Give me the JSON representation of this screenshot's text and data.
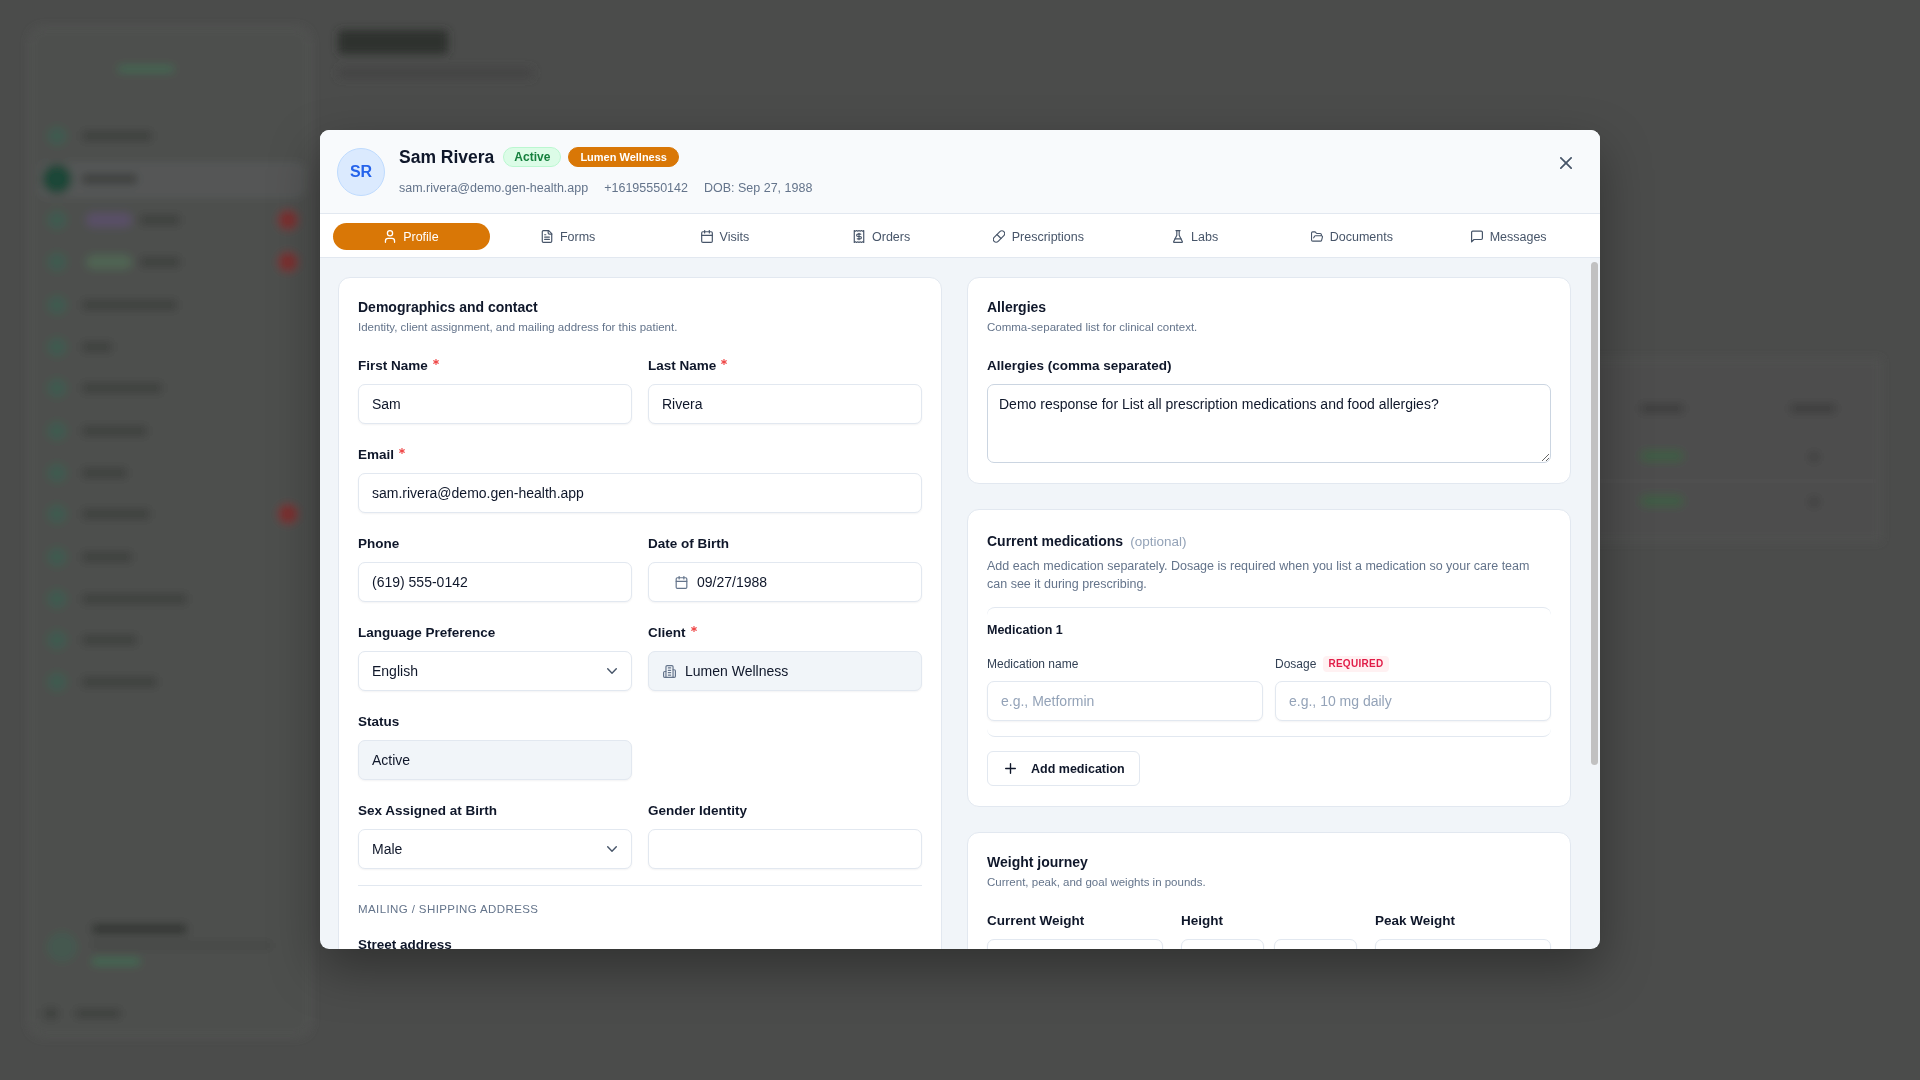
{
  "patient": {
    "initials": "SR",
    "name": "Sam Rivera",
    "badges": [
      {
        "label": "Active",
        "kind": "status"
      },
      {
        "label": "Lumen Wellness",
        "kind": "client"
      }
    ],
    "details": [
      "sam.rivera@demo.gen-health.app",
      "+16195550142",
      "DOB: Sep 27, 1988"
    ]
  },
  "tabs": [
    {
      "label": "Profile",
      "selected": true
    },
    {
      "label": "Forms",
      "selected": false
    },
    {
      "label": "Visits",
      "selected": false
    },
    {
      "label": "Orders",
      "selected": false
    },
    {
      "label": "Prescriptions",
      "selected": false
    },
    {
      "label": "Labs",
      "selected": false
    },
    {
      "label": "Documents",
      "selected": false
    },
    {
      "label": "Messages",
      "selected": false
    }
  ],
  "demographics": {
    "title": "Demographics and contact",
    "subtitle": "Identity, client assignment, and mailing address for this patient.",
    "rows": [
      [
        {
          "label": "First Name",
          "required": true,
          "kind": "text",
          "value": "Sam",
          "disabled": false
        },
        {
          "label": "Last Name",
          "required": true,
          "kind": "text",
          "value": "Rivera",
          "disabled": false
        }
      ],
      [
        {
          "label": "Email",
          "required": true,
          "kind": "email",
          "value": "sam.rivera@demo.gen-health.app",
          "disabled": false
        }
      ],
      [
        {
          "label": "Phone",
          "required": false,
          "kind": "text",
          "value": "(619) 555-0142",
          "disabled": false
        },
        {
          "label": "Date of Birth",
          "required": false,
          "kind": "date",
          "value": "09/27/1988",
          "disabled": false
        }
      ],
      [
        {
          "label": "Language Preference",
          "required": false,
          "kind": "select",
          "value": "English",
          "disabled": false
        },
        {
          "label": "Client",
          "required": true,
          "kind": "org",
          "value": "Lumen Wellness",
          "disabled": true
        }
      ],
      [
        {
          "label": "Status",
          "required": false,
          "kind": "text",
          "value": "Active",
          "disabled": true
        }
      ],
      [
        {
          "label": "Sex Assigned at Birth",
          "required": false,
          "kind": "select",
          "value": "Male",
          "disabled": false
        },
        {
          "label": "Gender Identity",
          "required": false,
          "kind": "text",
          "disabled": false
        }
      ]
    ],
    "section_heading": "MAILING / SHIPPING ADDRESS",
    "next_label": "Street address"
  },
  "allergies": {
    "title": "Allergies",
    "subtitle": "Comma-separated list for clinical context.",
    "label": "Allergies (comma separated)",
    "value": "Demo response for List all prescription medications and food allergies?"
  },
  "medications": {
    "title": "Current medications",
    "optional": "(optional)",
    "description": "Add each medication separately. Dosage is required when you list a medication so your care team can see it during prescribing.",
    "items": [
      {
        "heading": "Medication 1",
        "fields": [
          {
            "label": "Medication name",
            "placeholder": "e.g., Metformin"
          },
          {
            "label": "Dosage",
            "badge": "REQUIRED",
            "placeholder": "e.g., 10 mg daily"
          }
        ]
      }
    ],
    "add_button": "Add medication"
  },
  "weight": {
    "title": "Weight journey",
    "subtitle": "Current, peak, and goal weights in pounds.",
    "fields": [
      {
        "label": "Current Weight",
        "kind": "single"
      },
      {
        "label": "Height",
        "kind": "split"
      },
      {
        "label": "Peak Weight",
        "kind": "single"
      }
    ]
  }
}
